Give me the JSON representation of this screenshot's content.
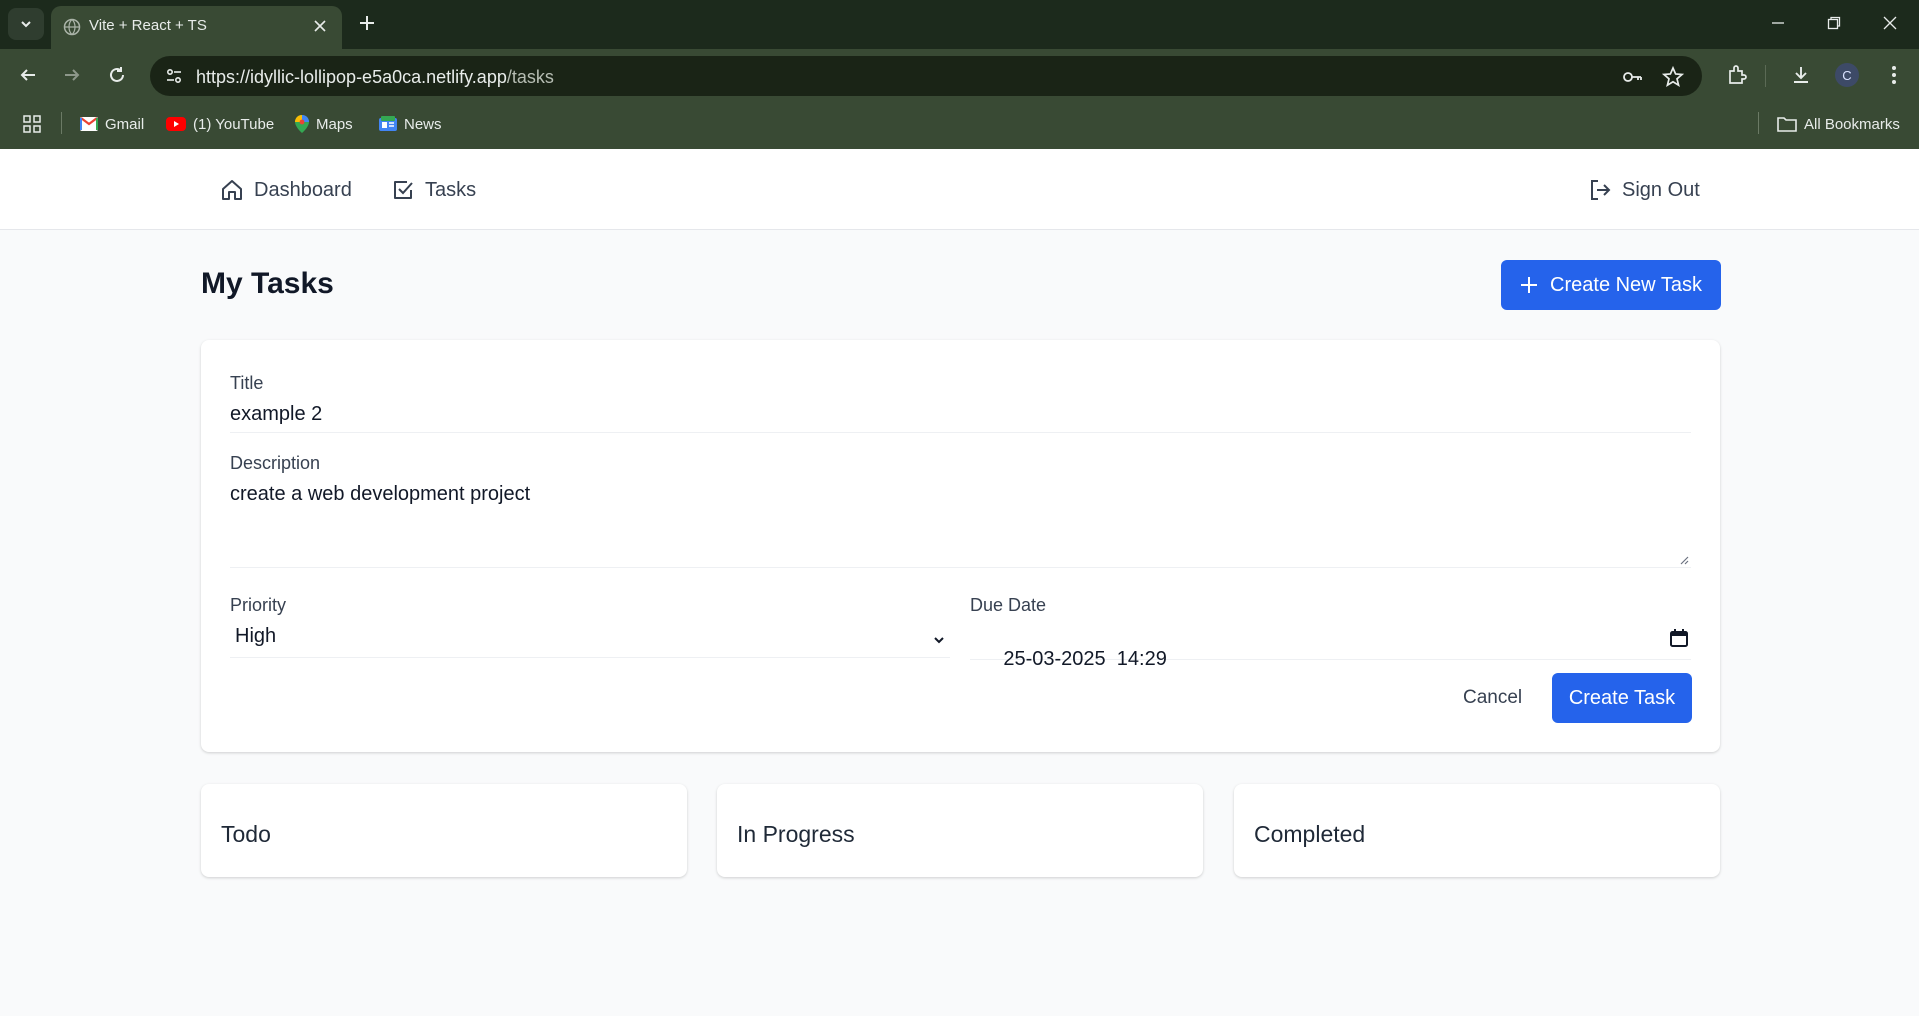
{
  "browser": {
    "tab_title": "Vite + React + TS",
    "url_host": "https://idyllic-lollipop-e5a0ca.netlify.app",
    "url_path": "/tasks",
    "profile_initial": "C",
    "bookmarks": [
      {
        "label": "Gmail",
        "icon": "gmail-icon"
      },
      {
        "label": "(1) YouTube",
        "icon": "youtube-icon"
      },
      {
        "label": "Maps",
        "icon": "maps-icon"
      },
      {
        "label": "News",
        "icon": "news-icon"
      }
    ],
    "all_bookmarks_label": "All Bookmarks"
  },
  "nav": {
    "dashboard_label": "Dashboard",
    "tasks_label": "Tasks",
    "signout_label": "Sign Out"
  },
  "page": {
    "title": "My Tasks",
    "create_new_label": "Create New Task"
  },
  "form": {
    "title_label": "Title",
    "title_value": "example 2",
    "description_label": "Description",
    "description_value": "create a web development project",
    "priority_label": "Priority",
    "priority_value": "High",
    "due_label": "Due Date",
    "due_value": "25-03-2025  14:29",
    "cancel_label": "Cancel",
    "submit_label": "Create Task"
  },
  "columns": [
    {
      "title": "Todo"
    },
    {
      "title": "In Progress"
    },
    {
      "title": "Completed"
    }
  ],
  "colors": {
    "accent": "#2563eb",
    "chrome_frame": "#1c2a1c",
    "chrome_toolbar": "#394a34",
    "page_bg": "#f9fafb"
  }
}
